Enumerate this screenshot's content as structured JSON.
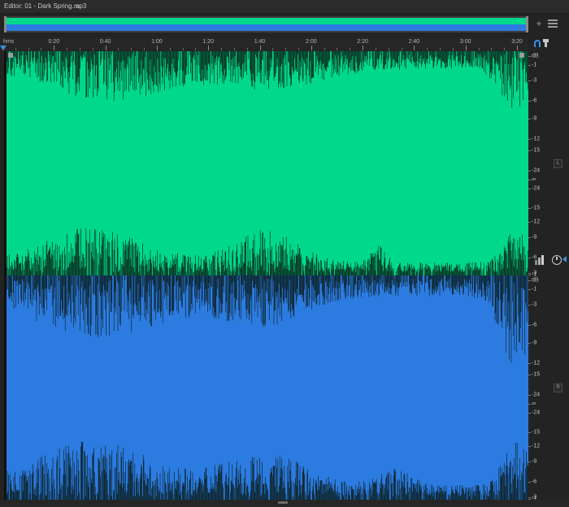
{
  "editor": {
    "title": "Editor: 01 - Dark Spring.mp3",
    "menu_glyph": "≡"
  },
  "ruler": {
    "unit": "hms",
    "ticks": [
      "0:20",
      "0:40",
      "1:00",
      "1:20",
      "1:40",
      "2:00",
      "2:20",
      "2:40",
      "3:00",
      "3:20"
    ]
  },
  "channels": [
    {
      "name": "L",
      "color": "#00d98b",
      "db_labels": [
        "dB",
        "-1",
        "-3",
        "-6",
        "-9",
        "-12",
        "-15",
        "-24",
        "∞",
        "-24",
        "-15",
        "-12",
        "-9",
        "-6",
        "-3",
        "-1"
      ]
    },
    {
      "name": "R",
      "color": "#2c7be0",
      "db_labels": [
        "dB",
        "-1",
        "-3",
        "-6",
        "-9",
        "-12",
        "-15",
        "-24",
        "∞",
        "-24",
        "-15",
        "-12",
        "-9",
        "-6",
        "-3",
        "-1"
      ]
    }
  ],
  "colors": {
    "background": "#232323",
    "accent": "#3b8fe6",
    "waveform_left": "#00d98b",
    "waveform_right": "#2c7be0"
  },
  "icons": {
    "menu": "hamburger-icon",
    "zoom": "zoom-icon",
    "panel_menu": "panel-menu-icon",
    "snap": "snap-icon",
    "pin": "pin-icon",
    "vertical_zoom": "vertical-zoom-icon",
    "clock": "clock-icon"
  }
}
